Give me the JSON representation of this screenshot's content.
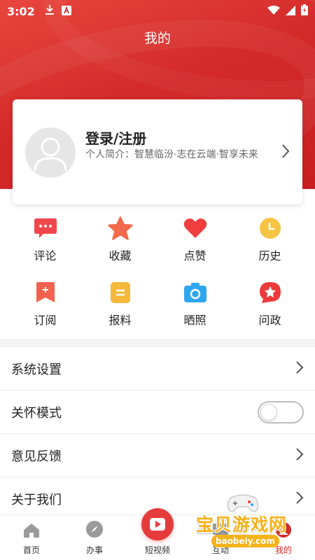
{
  "status_bar": {
    "time": "3:02"
  },
  "header": {
    "title": "我的"
  },
  "profile": {
    "login_label": "登录/注册",
    "bio": "个人简介：智慧临汾·志在云端·智享未来"
  },
  "shortcuts": [
    {
      "label": "评论",
      "icon": "comment-icon",
      "color": "#f0474d"
    },
    {
      "label": "收藏",
      "icon": "star-icon",
      "color": "#f26a4b"
    },
    {
      "label": "点赞",
      "icon": "heart-icon",
      "color": "#f03d3d"
    },
    {
      "label": "历史",
      "icon": "clock-icon",
      "color": "#f6c342"
    },
    {
      "label": "订阅",
      "icon": "bookmark-icon",
      "color": "#f2624c"
    },
    {
      "label": "报料",
      "icon": "report-icon",
      "color": "#f6b83a"
    },
    {
      "label": "晒照",
      "icon": "camera-icon",
      "color": "#2fa6f0"
    },
    {
      "label": "问政",
      "icon": "star-badge-icon",
      "color": "#ec3a3a"
    }
  ],
  "settings": {
    "system": "系统设置",
    "care_mode": "关怀模式",
    "care_mode_on": false,
    "feedback": "意见反馈",
    "about": "关于我们"
  },
  "tabbar": {
    "home": "首页",
    "services": "办事",
    "short_video": "短视频",
    "interact": "互动",
    "mine": "我的"
  },
  "watermark": {
    "title": "宝贝游戏网",
    "url": "baobeiy.com"
  },
  "colors": {
    "brand_red": "#d42b2a",
    "watermark_yellow": "#f5b21a"
  }
}
